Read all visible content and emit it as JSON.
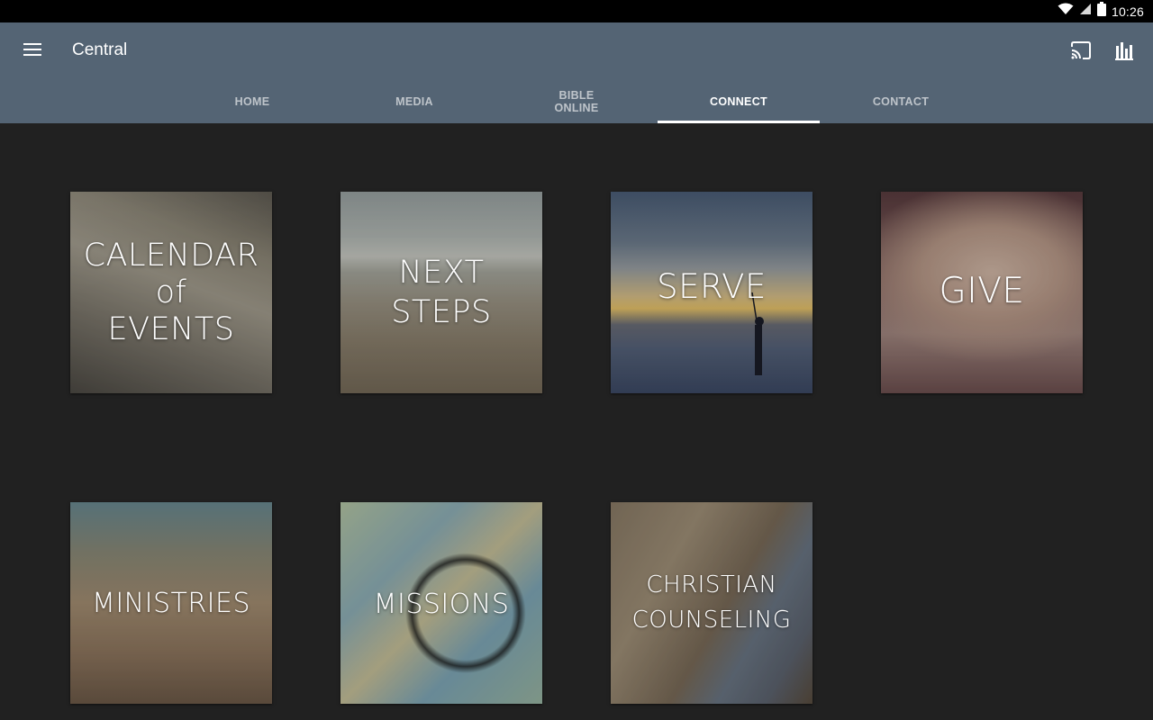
{
  "status_bar": {
    "time": "10:26",
    "icons": [
      "wifi-icon",
      "signal-icon",
      "battery-icon"
    ]
  },
  "app_bar": {
    "title": "Central",
    "background": "#546474",
    "icons": [
      "menu-icon",
      "cast-icon",
      "stats-icon"
    ]
  },
  "tabs": [
    {
      "label": "HOME",
      "active": false
    },
    {
      "label": "MEDIA",
      "active": false
    },
    {
      "label": "BIBLE\nONLINE",
      "active": false
    },
    {
      "label": "CONNECT",
      "active": true
    },
    {
      "label": "CONTACT",
      "active": false
    }
  ],
  "tiles": [
    {
      "lines": [
        "CALENDAR",
        "of",
        "EVENTS"
      ]
    },
    {
      "lines": [
        "NEXT",
        "STEPS"
      ]
    },
    {
      "lines": [
        "SERVE"
      ]
    },
    {
      "lines": [
        "GIVE"
      ]
    },
    {
      "lines": [
        "MINISTRIES"
      ]
    },
    {
      "lines": [
        "MISSIONS"
      ]
    },
    {
      "lines": [
        "CHRISTIAN",
        "COUNSELING"
      ]
    }
  ],
  "colors": {
    "page_background": "#212121",
    "tab_indicator": "#ffffff"
  }
}
